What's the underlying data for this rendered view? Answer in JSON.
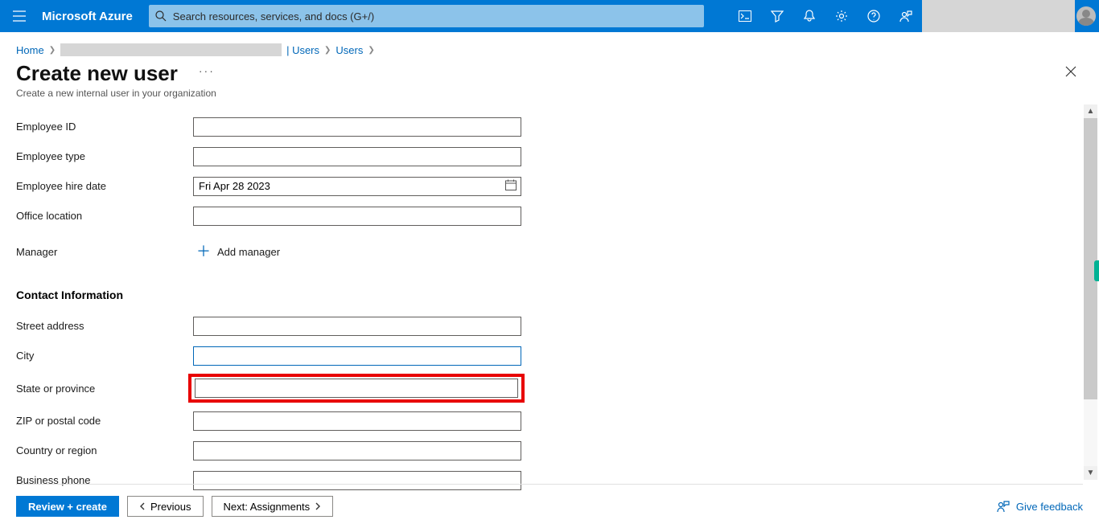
{
  "topbar": {
    "brand": "Microsoft Azure",
    "search_placeholder": "Search resources, services, and docs (G+/)"
  },
  "breadcrumb": {
    "home": "Home",
    "users_parent_suffix": "| Users",
    "users": "Users"
  },
  "header": {
    "title": "Create new user",
    "subtitle": "Create a new internal user in your organization"
  },
  "labels": {
    "emp_id": "Employee ID",
    "emp_type": "Employee type",
    "emp_hire_date": "Employee hire date",
    "office_location": "Office location",
    "manager": "Manager",
    "add_manager": "Add manager",
    "contact_section": "Contact Information",
    "street": "Street address",
    "city": "City",
    "state": "State or province",
    "zip": "ZIP or postal code",
    "country": "Country or region",
    "business_phone": "Business phone"
  },
  "values": {
    "emp_id": "",
    "emp_type": "",
    "hire_date": "Fri Apr 28 2023",
    "office_location": "",
    "street": "",
    "city": "",
    "state": "",
    "zip": "",
    "country": "",
    "business_phone": ""
  },
  "footer": {
    "review": "Review + create",
    "previous": "Previous",
    "next": "Next: Assignments",
    "feedback": "Give feedback"
  }
}
